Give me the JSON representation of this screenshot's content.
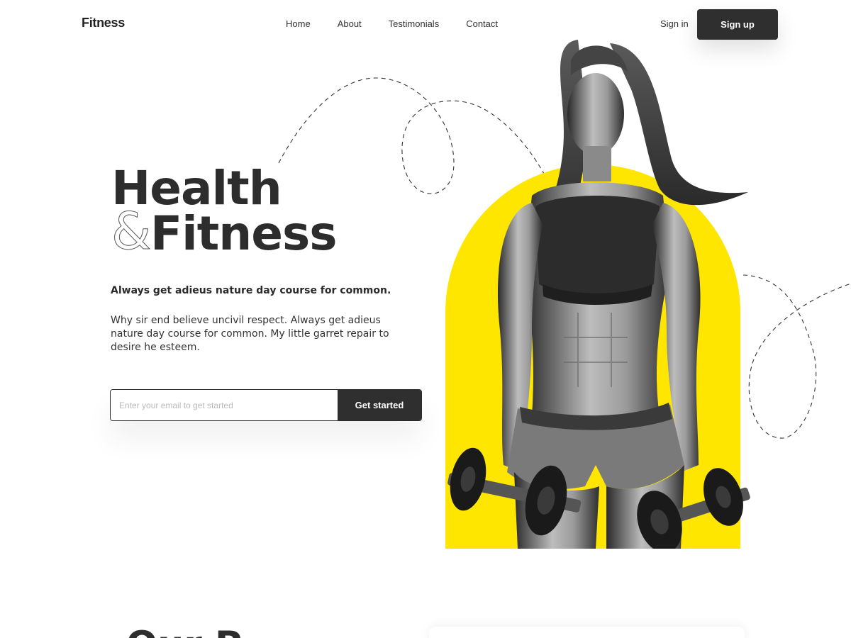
{
  "nav": {
    "logo": "Fitness",
    "links": [
      "Home",
      "About",
      "Testimonials",
      "Contact"
    ],
    "signin": "Sign in",
    "signup": "Sign up"
  },
  "hero": {
    "title_line1": "Health",
    "ampersand": "&",
    "title_line2": "Fitness",
    "subhead": "Always get adieus nature day course for common.",
    "description": "Why sir end believe uncivil respect. Always get adieus nature day course for common. My little garret repair to desire he esteem.",
    "email_placeholder": "Enter your email to get started",
    "cta": "Get started"
  },
  "next_section": {
    "heading_peek": "Our P"
  },
  "colors": {
    "accent_yellow": "#ffe600",
    "dark": "#2f2f2f",
    "text": "#2b2b2b"
  }
}
